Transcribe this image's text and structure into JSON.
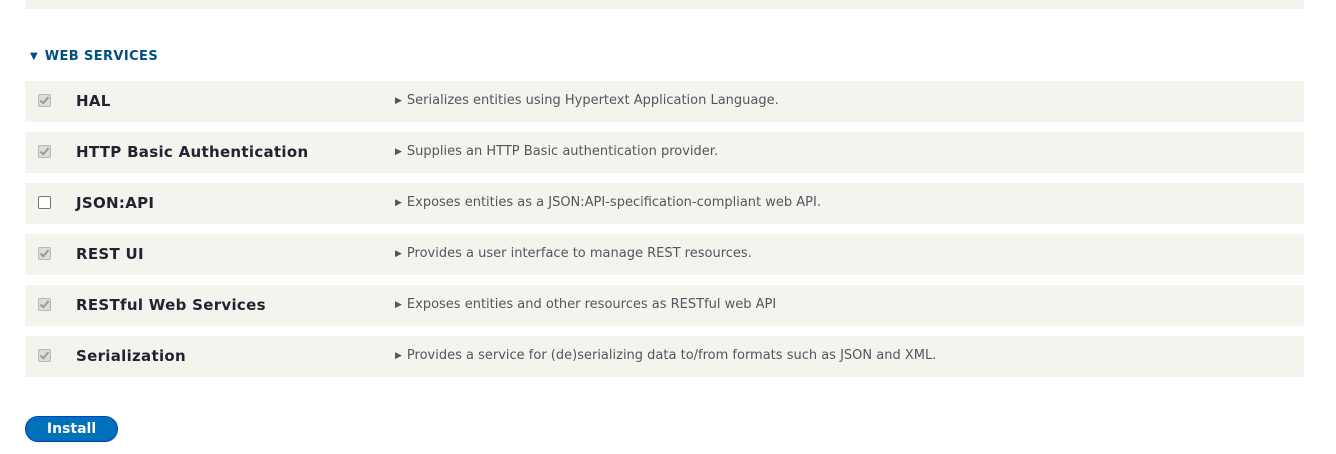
{
  "section": {
    "title": "WEB SERVICES",
    "toggle_icon": "triangle-down-icon"
  },
  "modules": [
    {
      "name": "HAL",
      "description": "Serializes entities using Hypertext Application Language.",
      "checked": true,
      "disabled": true
    },
    {
      "name": "HTTP Basic Authentication",
      "description": "Supplies an HTTP Basic authentication provider.",
      "checked": true,
      "disabled": true
    },
    {
      "name": "JSON:API",
      "description": "Exposes entities as a JSON:API-specification-compliant web API.",
      "checked": false,
      "disabled": false
    },
    {
      "name": "REST UI",
      "description": "Provides a user interface to manage REST resources.",
      "checked": true,
      "disabled": true
    },
    {
      "name": "RESTful Web Services",
      "description": "Exposes entities and other resources as RESTful web API",
      "checked": true,
      "disabled": true
    },
    {
      "name": "Serialization",
      "description": "Provides a service for (de)serializing data to/from formats such as JSON and XML.",
      "checked": true,
      "disabled": true
    }
  ],
  "actions": {
    "install_label": "Install"
  },
  "colors": {
    "accent": "#004f80",
    "button": "#0071b8",
    "row_background": "#f3f4ee"
  }
}
